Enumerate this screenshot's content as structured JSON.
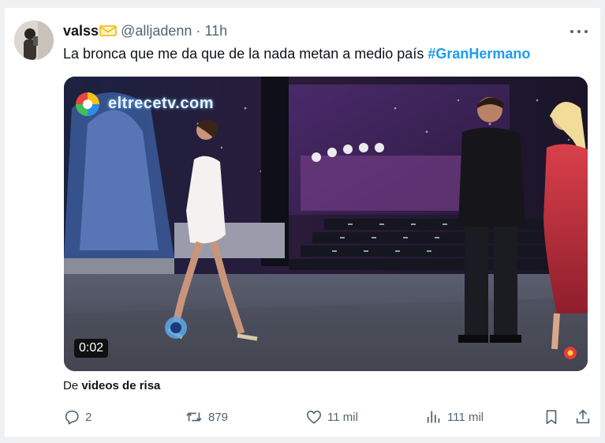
{
  "tweet": {
    "display_name": "valss",
    "handle": "@alljadenn",
    "separator": "·",
    "time": "11h",
    "text": "La bronca que me da que de la nada metan a medio país ",
    "hashtag": "#GranHermano"
  },
  "media": {
    "channel_logo": "eltrecetv.com",
    "duration": "0:02"
  },
  "source": {
    "prefix": "De ",
    "name": "videos de risa"
  },
  "actions": {
    "replies": "2",
    "retweets": "879",
    "likes": "11 mil",
    "views": "111 mil"
  },
  "colors": {
    "accent": "#1d9bf0",
    "secondary_text": "#536471",
    "background": "#eef0f2"
  },
  "icons": [
    "more-icon",
    "reply-icon",
    "retweet-icon",
    "like-icon",
    "views-icon",
    "bookmark-icon",
    "share-icon"
  ]
}
